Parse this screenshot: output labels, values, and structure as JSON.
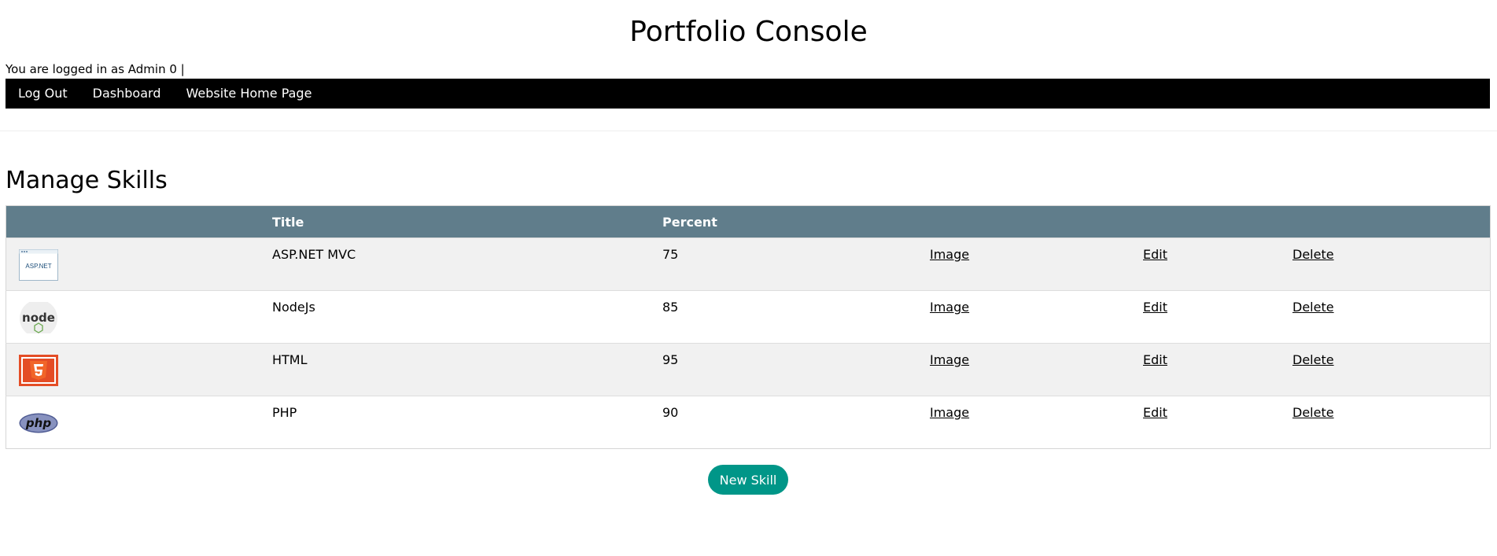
{
  "header": {
    "title": "Portfolio Console",
    "login_text": "You are logged in as Admin 0 |"
  },
  "nav": {
    "items": [
      {
        "label": "Log Out"
      },
      {
        "label": "Dashboard"
      },
      {
        "label": "Website Home Page"
      }
    ]
  },
  "main": {
    "section_title": "Manage Skills",
    "table": {
      "columns": [
        "",
        "Title",
        "Percent",
        "",
        "",
        ""
      ],
      "rows": [
        {
          "logo": "aspnet-logo",
          "title": "ASP.NET MVC",
          "percent": "75",
          "image_link": "Image",
          "edit_link": "Edit",
          "delete_link": "Delete"
        },
        {
          "logo": "nodejs-logo",
          "title": "NodeJs",
          "percent": "85",
          "image_link": "Image",
          "edit_link": "Edit",
          "delete_link": "Delete"
        },
        {
          "logo": "html5-logo",
          "title": "HTML",
          "percent": "95",
          "image_link": "Image",
          "edit_link": "Edit",
          "delete_link": "Delete"
        },
        {
          "logo": "php-logo",
          "title": "PHP",
          "percent": "90",
          "image_link": "Image",
          "edit_link": "Edit",
          "delete_link": "Delete"
        }
      ]
    },
    "new_button_label": "New Skill"
  },
  "colors": {
    "navbar": "#000000",
    "table_header": "#607d8b",
    "row_stripe": "#f1f1f1",
    "button": "#009688"
  },
  "logo_text": {
    "aspnet": "ASP.NET",
    "node": "node",
    "php": "php"
  }
}
